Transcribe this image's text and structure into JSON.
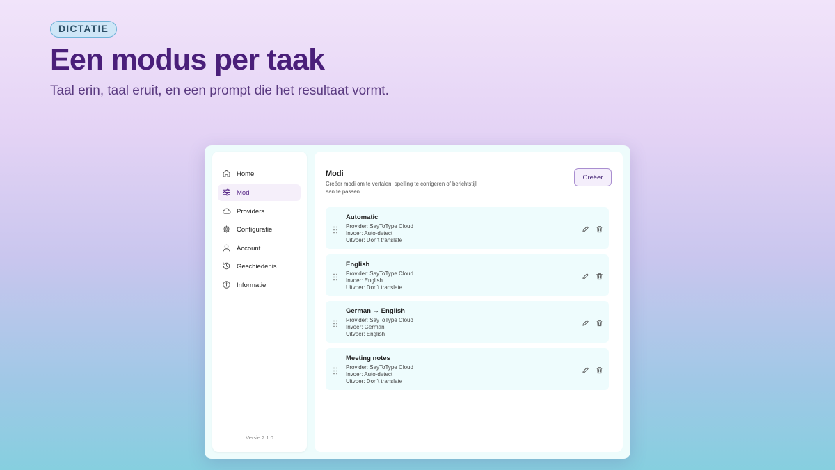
{
  "hero": {
    "badge": "DICTATIE",
    "title": "Een modus per taak",
    "subtitle": "Taal erin, taal eruit, en een prompt die het resultaat vormt."
  },
  "sidebar": {
    "items": [
      {
        "label": "Home",
        "icon": "home-icon"
      },
      {
        "label": "Modi",
        "icon": "sliders-icon",
        "active": true
      },
      {
        "label": "Providers",
        "icon": "cloud-icon"
      },
      {
        "label": "Configuratie",
        "icon": "gear-icon"
      },
      {
        "label": "Account",
        "icon": "user-icon"
      },
      {
        "label": "Geschiedenis",
        "icon": "history-icon"
      },
      {
        "label": "Informatie",
        "icon": "info-icon"
      }
    ],
    "version": "Versie 2.1.0"
  },
  "main": {
    "title": "Modi",
    "description": "Creëer modi om te vertalen, spelling te corrigeren of berichtstijl aan te passen",
    "create_label": "Creëer",
    "modes": [
      {
        "name": "Automatic",
        "provider": "Provider: SayToType Cloud",
        "input": "Invoer: Auto-detect",
        "output": "Uitvoer: Don't translate"
      },
      {
        "name": "English",
        "provider": "Provider: SayToType Cloud",
        "input": "Invoer: English",
        "output": "Uitvoer: Don't translate"
      },
      {
        "name": "German → English",
        "provider": "Provider: SayToType Cloud",
        "input": "Invoer: German",
        "output": "Uitvoer: English"
      },
      {
        "name": "Meeting notes",
        "provider": "Provider: SayToType Cloud",
        "input": "Invoer: Auto-detect",
        "output": "Uitvoer: Don't translate"
      }
    ]
  },
  "colors": {
    "title": "#4a1f7a",
    "accent": "#5b2c8a",
    "badge_border": "#6fb3d8",
    "card_bg": "#eefcfd"
  }
}
